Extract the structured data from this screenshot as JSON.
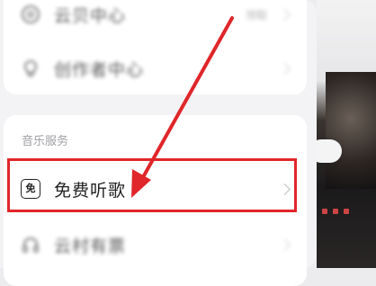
{
  "drawer": {
    "items_top": [
      {
        "label": "云贝中心",
        "badge": "领取"
      },
      {
        "label": "创作者中心"
      }
    ],
    "section_title": "音乐服务",
    "items_music": [
      {
        "label": "免费听歌",
        "icon_text": "免",
        "highlighted": true
      },
      {
        "label": "云村有票"
      }
    ]
  },
  "annotation": {
    "color": "#e0262a"
  }
}
